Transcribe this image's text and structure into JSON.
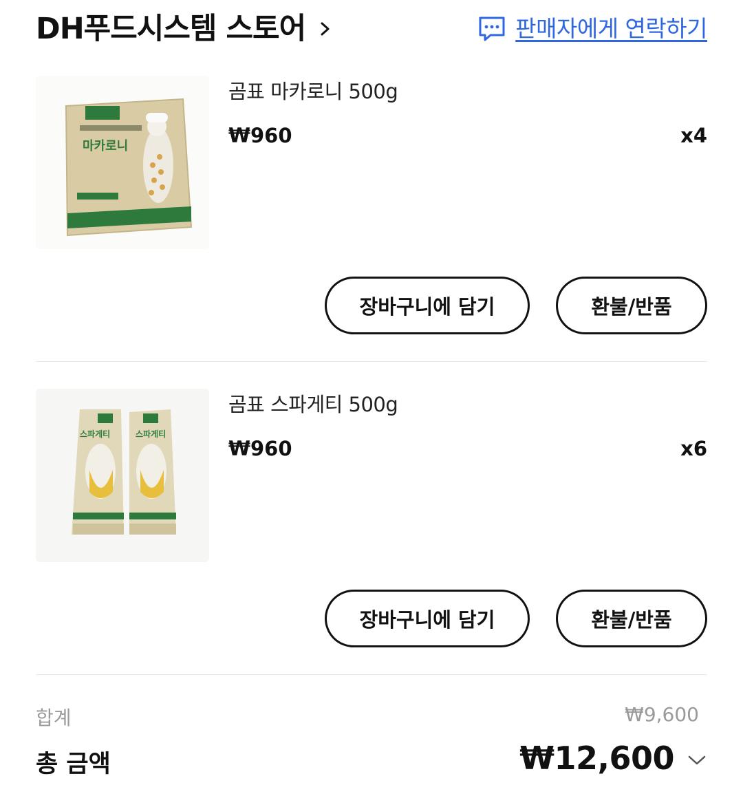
{
  "header": {
    "store_name": "DH푸드시스템 스토어",
    "contact_label": "판매자에게 연락하기",
    "chevron_icon": "chevron-right-icon",
    "contact_icon": "chat-bubble-icon",
    "link_color": "#2f67e0"
  },
  "items": [
    {
      "name": "곰표 마카로니 500g",
      "price": "₩960",
      "quantity": "x4",
      "cart_button": "장바구니에 담기",
      "refund_button": "환불/반품",
      "package_label": "마카로니"
    },
    {
      "name": "곰표 스파게티 500g",
      "price": "₩960",
      "quantity": "x6",
      "cart_button": "장바구니에 담기",
      "refund_button": "환불/반품",
      "package_label": "스파게티"
    }
  ],
  "summary": {
    "subtotal_label": "합계",
    "subtotal_value": "₩9,600",
    "total_label": "총 금액",
    "total_value": "₩12,600",
    "expand_icon": "chevron-down-icon"
  }
}
